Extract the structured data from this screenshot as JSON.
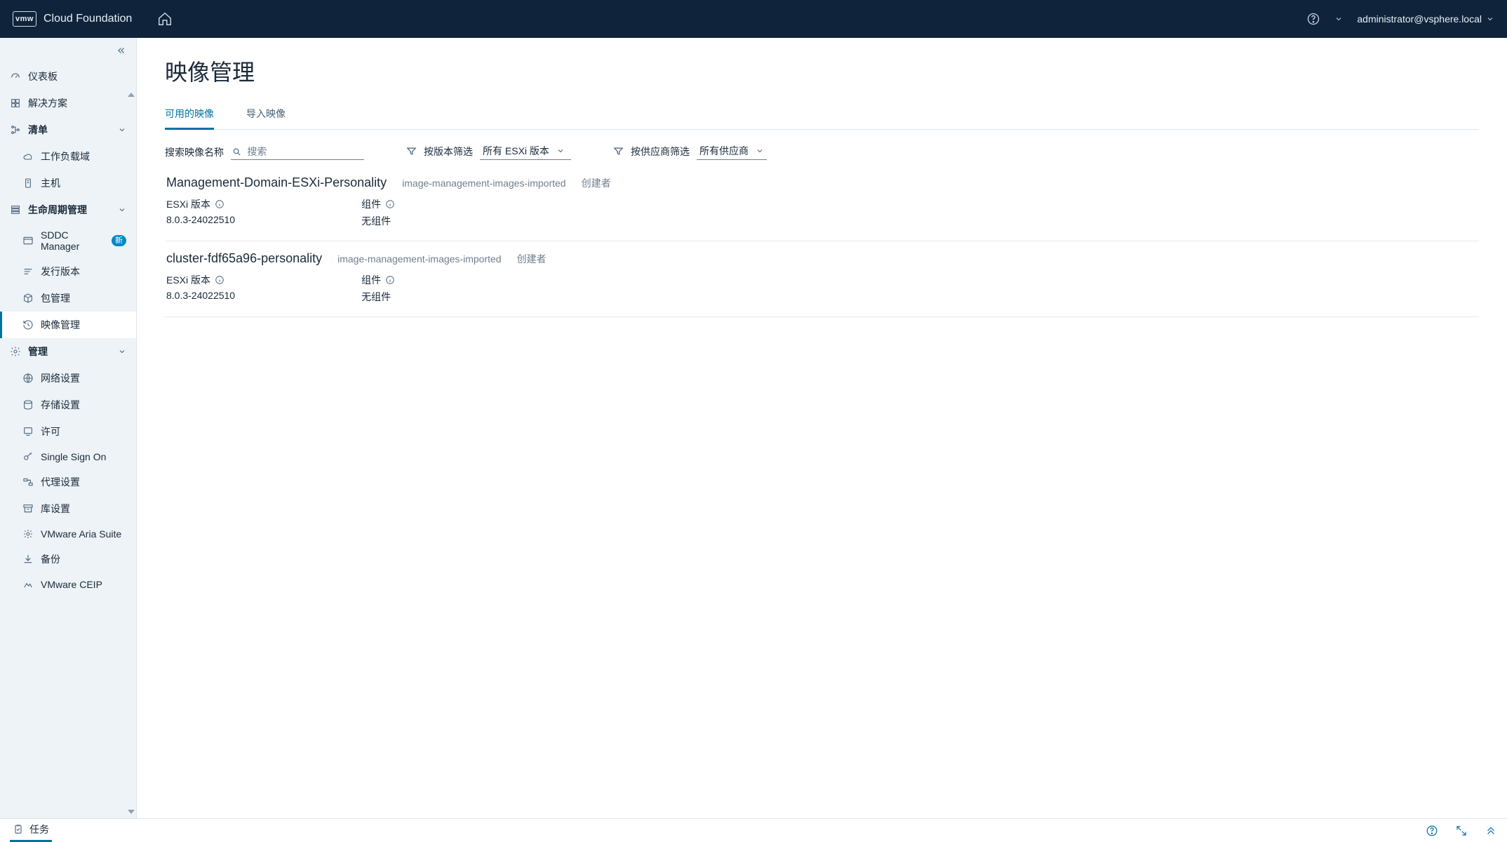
{
  "header": {
    "badge": "vmw",
    "product": "Cloud Foundation",
    "user": "administrator@vsphere.local"
  },
  "sidebar": {
    "dashboard": "仪表板",
    "solutions": "解决方案",
    "inventory_group": "清单",
    "workload_domain": "工作负载域",
    "host": "主机",
    "lifecycle_group": "生命周期管理",
    "sddc_manager": "SDDC Manager",
    "sddc_badge": "新",
    "release": "发行版本",
    "package": "包管理",
    "image_mgmt": "映像管理",
    "admin_group": "管理",
    "network": "网络设置",
    "storage": "存储设置",
    "license": "许可",
    "sso": "Single Sign On",
    "proxy": "代理设置",
    "repo": "库设置",
    "aria": "VMware Aria Suite",
    "backup": "备份",
    "ceip": "VMware CEIP"
  },
  "page": {
    "title": "映像管理",
    "tab_available": "可用的映像",
    "tab_import": "导入映像",
    "search_label": "搜索映像名称",
    "search_placeholder": "搜索",
    "filter_version_label": "按版本筛选",
    "filter_version_value": "所有 ESXi 版本",
    "filter_vendor_label": "按供应商筛选",
    "filter_vendor_value": "所有供应商",
    "esxi_version_label": "ESXi 版本",
    "components_label": "组件",
    "created_by_label": "创建者"
  },
  "images": [
    {
      "name": "Management-Domain-ESXi-Personality",
      "tag": "image-management-images-imported",
      "esxi_version": "8.0.3-24022510",
      "components": "无组件"
    },
    {
      "name": "cluster-fdf65a96-personality",
      "tag": "image-management-images-imported",
      "esxi_version": "8.0.3-24022510",
      "components": "无组件"
    }
  ],
  "footer": {
    "tasks": "任务"
  }
}
